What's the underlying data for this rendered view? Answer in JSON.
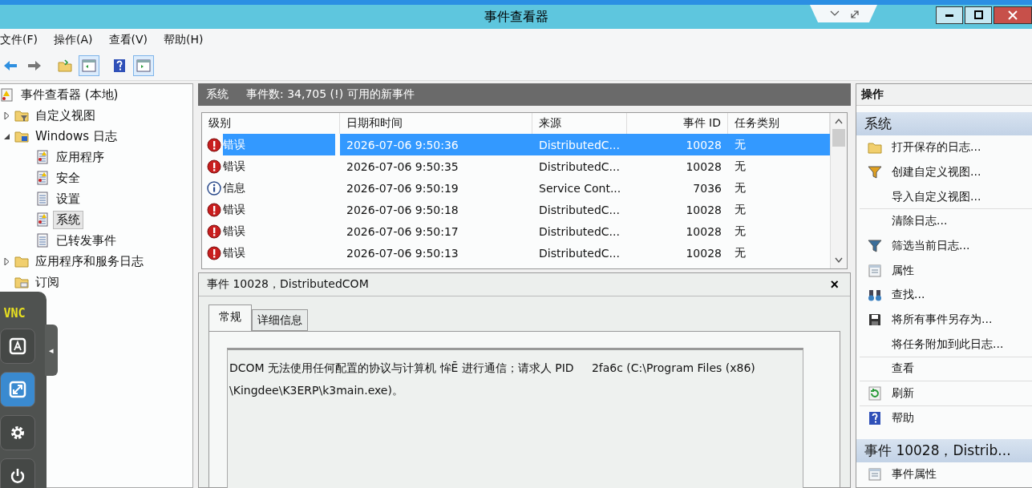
{
  "window": {
    "title": "事件查看器"
  },
  "menu": [
    "文件(F)",
    "操作(A)",
    "查看(V)",
    "帮助(H)"
  ],
  "toolbar": [
    {
      "kind": "back",
      "pressed": false
    },
    {
      "kind": "forward",
      "pressed": false
    },
    {
      "kind": "folder",
      "pressed": false
    },
    {
      "kind": "pane",
      "pressed": true
    },
    {
      "kind": "help",
      "pressed": false
    },
    {
      "kind": "pane-right",
      "pressed": true
    }
  ],
  "tree": [
    {
      "label": "事件查看器 (本地)",
      "kind": "viewer",
      "selected": false,
      "children": [
        {
          "label": "自定义视图",
          "kind": "folder-filter",
          "selected": false,
          "expanded": false
        },
        {
          "label": "Windows 日志",
          "kind": "folder-windows",
          "selected": false,
          "expanded": true,
          "children": [
            {
              "label": "应用程序",
              "kind": "log-warn",
              "selected": false
            },
            {
              "label": "安全",
              "kind": "log-warn",
              "selected": false
            },
            {
              "label": "设置",
              "kind": "log",
              "selected": false
            },
            {
              "label": "系统",
              "kind": "log-warn",
              "selected": true
            },
            {
              "label": "已转发事件",
              "kind": "log",
              "selected": false
            }
          ]
        },
        {
          "label": "应用程序和服务日志",
          "kind": "folder",
          "selected": false,
          "expanded": false
        },
        {
          "label": "订阅",
          "kind": "folder-sub",
          "selected": false
        }
      ]
    }
  ],
  "log_header": {
    "title": "系统",
    "summary": "事件数: 34,705 (!) 可用的新事件"
  },
  "table": {
    "columns": [
      "级别",
      "日期和时间",
      "来源",
      "事件 ID",
      "任务类别"
    ],
    "rows": [
      {
        "kind": "error",
        "level_text": "错误",
        "date": "2026-07-06 9:50:36",
        "source": "DistributedC...",
        "event_id": "10028",
        "task": "无",
        "selected": true
      },
      {
        "kind": "error",
        "level_text": "错误",
        "date": "2026-07-06 9:50:35",
        "source": "DistributedC...",
        "event_id": "10028",
        "task": "无",
        "selected": false
      },
      {
        "kind": "info",
        "level_text": "信息",
        "date": "2026-07-06 9:50:19",
        "source": "Service Cont...",
        "event_id": "7036",
        "task": "无",
        "selected": false
      },
      {
        "kind": "error",
        "level_text": "错误",
        "date": "2026-07-06 9:50:18",
        "source": "DistributedC...",
        "event_id": "10028",
        "task": "无",
        "selected": false
      },
      {
        "kind": "error",
        "level_text": "错误",
        "date": "2026-07-06 9:50:17",
        "source": "DistributedC...",
        "event_id": "10028",
        "task": "无",
        "selected": false
      },
      {
        "kind": "error",
        "level_text": "错误",
        "date": "2026-07-06 9:50:13",
        "source": "DistributedC...",
        "event_id": "10028",
        "task": "无",
        "selected": false
      }
    ]
  },
  "detail": {
    "title": "事件 10028，DistributedCOM",
    "close": "×",
    "tabs": [
      {
        "label": "常规",
        "selected": true
      },
      {
        "label": "详细信息",
        "selected": false
      }
    ],
    "lines": [
      "DCOM 无法使用任何配置的协议与计算机 恈Ē 进行通信；请求人 PID     2fa6c (C:\\Program Files (x86)",
      "\\Kingdee\\K3ERP\\k3main.exe)。"
    ]
  },
  "actions": {
    "title": "操作",
    "sections": [
      {
        "title": "系统",
        "items": [
          {
            "label": "打开保存的日志...",
            "kind": "folder",
            "separator_after": false
          },
          {
            "label": "创建自定义视图...",
            "kind": "funnel-gold",
            "separator_after": false
          },
          {
            "label": "导入自定义视图...",
            "kind": "plain",
            "separator_after": true
          },
          {
            "label": "清除日志...",
            "kind": "plain",
            "separator_after": false
          },
          {
            "label": "筛选当前日志...",
            "kind": "funnel",
            "separator_after": false
          },
          {
            "label": "属性",
            "kind": "properties",
            "separator_after": false
          },
          {
            "label": "查找...",
            "kind": "binoculars",
            "separator_after": false
          },
          {
            "label": "将所有事件另存为...",
            "kind": "save",
            "separator_after": false
          },
          {
            "label": "将任务附加到此日志...",
            "kind": "plain",
            "separator_after": true
          },
          {
            "label": "查看",
            "kind": "plain",
            "separator_after": true
          },
          {
            "label": "刷新",
            "kind": "refresh",
            "separator_after": true
          },
          {
            "label": "帮助",
            "kind": "help",
            "separator_after": false
          }
        ]
      },
      {
        "title": "事件 10028，Distrib...",
        "items": [
          {
            "label": "事件属性",
            "kind": "properties",
            "separator_after": false
          }
        ]
      }
    ]
  },
  "vnc_toolbar": {
    "logo": "VNC",
    "buttons": [
      {
        "kind": "keyboard",
        "selected": false
      },
      {
        "kind": "fullscreen",
        "selected": true
      },
      {
        "kind": "settings",
        "selected": false
      },
      {
        "kind": "power",
        "selected": false
      }
    ],
    "collapse": "◂"
  }
}
